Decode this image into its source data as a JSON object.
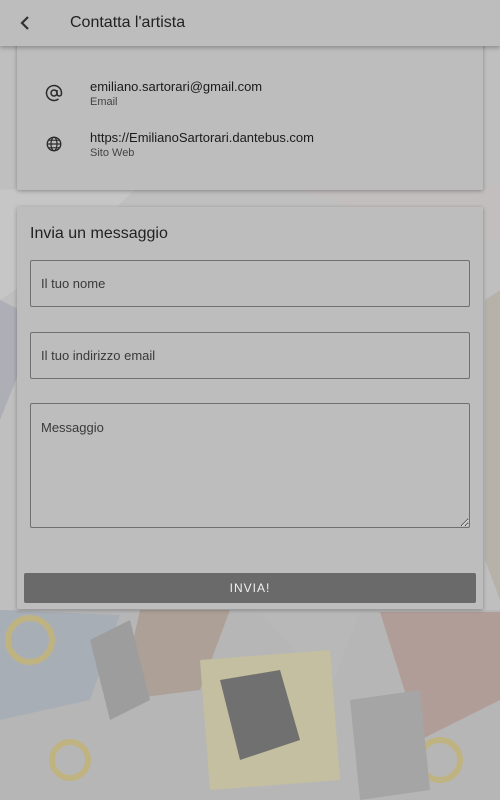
{
  "appbar": {
    "title": "Contatta l'artista",
    "back_icon": "chevron-left-icon"
  },
  "contact": {
    "email": {
      "icon": "at-sign-icon",
      "value": "emiliano.sartorari@gmail.com",
      "label": "Email"
    },
    "website": {
      "icon": "globe-icon",
      "value": "https://EmilianoSartorari.dantebus.com",
      "label": "Sito Web"
    }
  },
  "message_form": {
    "title": "Invia un messaggio",
    "name_placeholder": "Il tuo nome",
    "email_placeholder": "Il tuo indirizzo email",
    "message_placeholder": "Messaggio",
    "send_label": "INVIA!"
  },
  "colors": {
    "appbar": "#bdbdbd",
    "card": "#bdbdbd",
    "button": "#6a6a6a",
    "button_text": "#f0f0f0"
  }
}
